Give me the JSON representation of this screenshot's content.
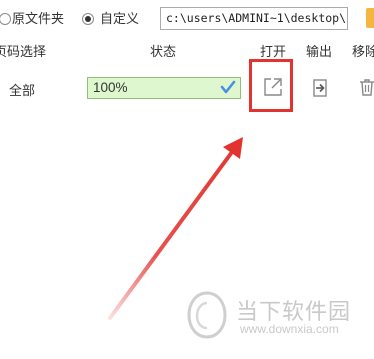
{
  "options": {
    "source_folder_label": "原文件夹",
    "custom_label": "自定义",
    "custom_selected": true,
    "path_value": "c:\\users\\ADMINI~1\\desktop\\"
  },
  "table": {
    "headers": {
      "page_select": "页码选择",
      "status": "状态",
      "open": "打开",
      "output": "输出",
      "remove": "移除"
    },
    "rows": [
      {
        "page_select": "全部",
        "status": "100%"
      }
    ]
  },
  "watermark": {
    "name": "当下软件园",
    "url": "www.downxia.com"
  },
  "colors": {
    "highlight": "#e3332f",
    "status_fill": "#dff7cf",
    "check": "#4a90e2"
  }
}
